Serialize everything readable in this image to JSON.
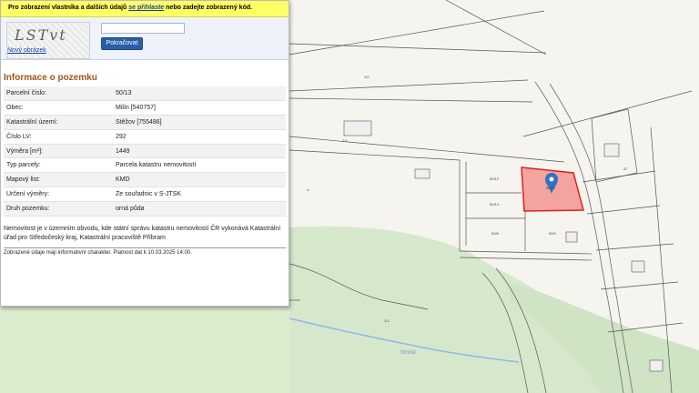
{
  "captcha": {
    "banner_prefix": "Pro zobrazení vlastníka a dalších údajů",
    "banner_link": "se přihlaste",
    "banner_suffix": "nebo zadejte zobrazený kód.",
    "captcha_text": "LSTvt",
    "new_image_link": "Nový obrázek",
    "input_value": "",
    "continue_button": "Pokračovat"
  },
  "parcel": {
    "section_title": "Informace o pozemku",
    "rows": [
      {
        "label": "Parcelní číslo:",
        "value": "50/13"
      },
      {
        "label": "Obec:",
        "value": "Milín [540757]"
      },
      {
        "label": "Katastrální území:",
        "value": "Stěžov [755486]"
      },
      {
        "label": "Číslo LV:",
        "value": "292"
      },
      {
        "label": "Výměra [m²]:",
        "value": "1449"
      },
      {
        "label": "Typ parcely:",
        "value": "Parcela katastru nemovitostí"
      },
      {
        "label": "Mapový list:",
        "value": "KMD"
      },
      {
        "label": "Určení výměry:",
        "value": "Ze souřadnic v S-JTSK"
      },
      {
        "label": "Druh pozemku:",
        "value": "orná půda"
      }
    ],
    "note": "Nemovitost je v územním obvodu, kde státní správu katastru nemovitostí ČR vykonává Katastrální úřad pro Středočeský kraj, Katastrální pracoviště Příbram",
    "validity": "Zobrazené údaje mají informativní charakter. Platnost dat k 10.03.2025 14:00."
  },
  "map": {
    "stream_label": "Strošil",
    "parcel_labels": [
      "50/13",
      "50/12",
      "50/14",
      "50/8",
      "50/9",
      "2/1",
      "1/2",
      "57",
      "1/1",
      "4"
    ],
    "colors": {
      "background": "#f6f4ee",
      "selected_fill": "#f4a4a0",
      "selected_stroke": "#e0201c",
      "pin": "#2f72c6",
      "green": "#d6e8cc",
      "stream": "#8db8e3"
    }
  }
}
